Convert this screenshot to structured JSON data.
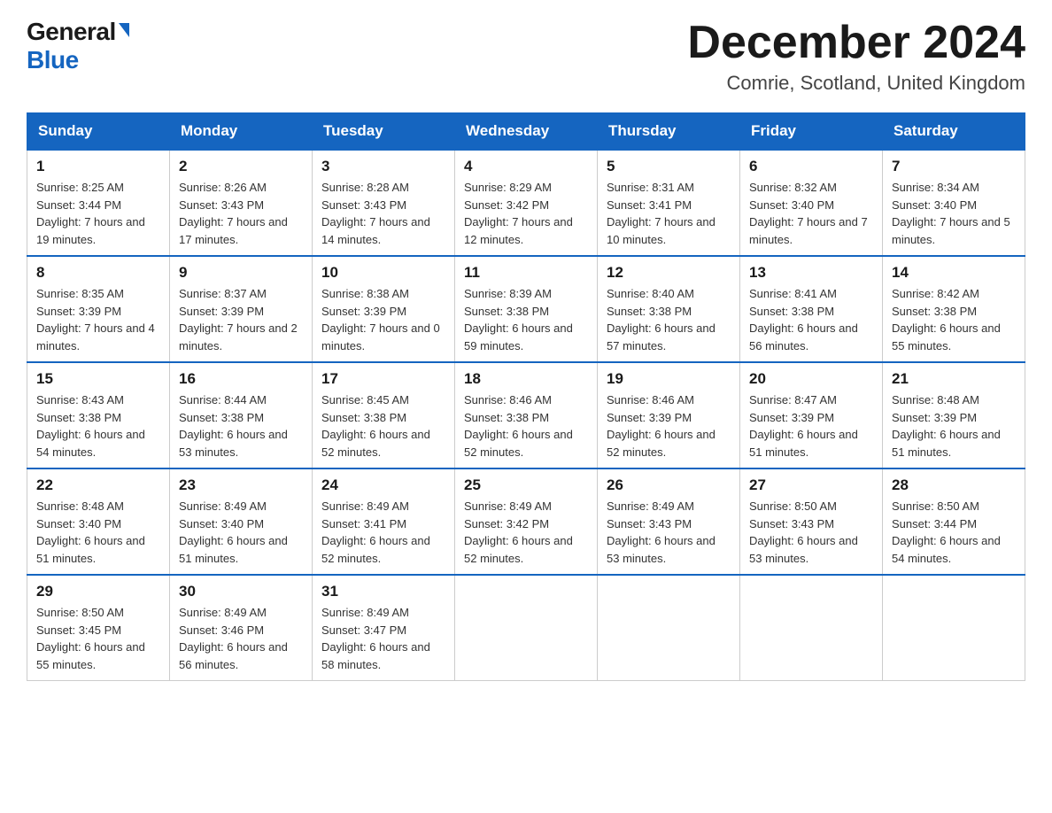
{
  "header": {
    "logo_general": "General",
    "logo_blue": "Blue",
    "title": "December 2024",
    "location": "Comrie, Scotland, United Kingdom"
  },
  "days_of_week": [
    "Sunday",
    "Monday",
    "Tuesday",
    "Wednesday",
    "Thursday",
    "Friday",
    "Saturday"
  ],
  "weeks": [
    [
      {
        "day": "1",
        "sunrise": "8:25 AM",
        "sunset": "3:44 PM",
        "daylight": "7 hours and 19 minutes."
      },
      {
        "day": "2",
        "sunrise": "8:26 AM",
        "sunset": "3:43 PM",
        "daylight": "7 hours and 17 minutes."
      },
      {
        "day": "3",
        "sunrise": "8:28 AM",
        "sunset": "3:43 PM",
        "daylight": "7 hours and 14 minutes."
      },
      {
        "day": "4",
        "sunrise": "8:29 AM",
        "sunset": "3:42 PM",
        "daylight": "7 hours and 12 minutes."
      },
      {
        "day": "5",
        "sunrise": "8:31 AM",
        "sunset": "3:41 PM",
        "daylight": "7 hours and 10 minutes."
      },
      {
        "day": "6",
        "sunrise": "8:32 AM",
        "sunset": "3:40 PM",
        "daylight": "7 hours and 7 minutes."
      },
      {
        "day": "7",
        "sunrise": "8:34 AM",
        "sunset": "3:40 PM",
        "daylight": "7 hours and 5 minutes."
      }
    ],
    [
      {
        "day": "8",
        "sunrise": "8:35 AM",
        "sunset": "3:39 PM",
        "daylight": "7 hours and 4 minutes."
      },
      {
        "day": "9",
        "sunrise": "8:37 AM",
        "sunset": "3:39 PM",
        "daylight": "7 hours and 2 minutes."
      },
      {
        "day": "10",
        "sunrise": "8:38 AM",
        "sunset": "3:39 PM",
        "daylight": "7 hours and 0 minutes."
      },
      {
        "day": "11",
        "sunrise": "8:39 AM",
        "sunset": "3:38 PM",
        "daylight": "6 hours and 59 minutes."
      },
      {
        "day": "12",
        "sunrise": "8:40 AM",
        "sunset": "3:38 PM",
        "daylight": "6 hours and 57 minutes."
      },
      {
        "day": "13",
        "sunrise": "8:41 AM",
        "sunset": "3:38 PM",
        "daylight": "6 hours and 56 minutes."
      },
      {
        "day": "14",
        "sunrise": "8:42 AM",
        "sunset": "3:38 PM",
        "daylight": "6 hours and 55 minutes."
      }
    ],
    [
      {
        "day": "15",
        "sunrise": "8:43 AM",
        "sunset": "3:38 PM",
        "daylight": "6 hours and 54 minutes."
      },
      {
        "day": "16",
        "sunrise": "8:44 AM",
        "sunset": "3:38 PM",
        "daylight": "6 hours and 53 minutes."
      },
      {
        "day": "17",
        "sunrise": "8:45 AM",
        "sunset": "3:38 PM",
        "daylight": "6 hours and 52 minutes."
      },
      {
        "day": "18",
        "sunrise": "8:46 AM",
        "sunset": "3:38 PM",
        "daylight": "6 hours and 52 minutes."
      },
      {
        "day": "19",
        "sunrise": "8:46 AM",
        "sunset": "3:39 PM",
        "daylight": "6 hours and 52 minutes."
      },
      {
        "day": "20",
        "sunrise": "8:47 AM",
        "sunset": "3:39 PM",
        "daylight": "6 hours and 51 minutes."
      },
      {
        "day": "21",
        "sunrise": "8:48 AM",
        "sunset": "3:39 PM",
        "daylight": "6 hours and 51 minutes."
      }
    ],
    [
      {
        "day": "22",
        "sunrise": "8:48 AM",
        "sunset": "3:40 PM",
        "daylight": "6 hours and 51 minutes."
      },
      {
        "day": "23",
        "sunrise": "8:49 AM",
        "sunset": "3:40 PM",
        "daylight": "6 hours and 51 minutes."
      },
      {
        "day": "24",
        "sunrise": "8:49 AM",
        "sunset": "3:41 PM",
        "daylight": "6 hours and 52 minutes."
      },
      {
        "day": "25",
        "sunrise": "8:49 AM",
        "sunset": "3:42 PM",
        "daylight": "6 hours and 52 minutes."
      },
      {
        "day": "26",
        "sunrise": "8:49 AM",
        "sunset": "3:43 PM",
        "daylight": "6 hours and 53 minutes."
      },
      {
        "day": "27",
        "sunrise": "8:50 AM",
        "sunset": "3:43 PM",
        "daylight": "6 hours and 53 minutes."
      },
      {
        "day": "28",
        "sunrise": "8:50 AM",
        "sunset": "3:44 PM",
        "daylight": "6 hours and 54 minutes."
      }
    ],
    [
      {
        "day": "29",
        "sunrise": "8:50 AM",
        "sunset": "3:45 PM",
        "daylight": "6 hours and 55 minutes."
      },
      {
        "day": "30",
        "sunrise": "8:49 AM",
        "sunset": "3:46 PM",
        "daylight": "6 hours and 56 minutes."
      },
      {
        "day": "31",
        "sunrise": "8:49 AM",
        "sunset": "3:47 PM",
        "daylight": "6 hours and 58 minutes."
      },
      null,
      null,
      null,
      null
    ]
  ]
}
